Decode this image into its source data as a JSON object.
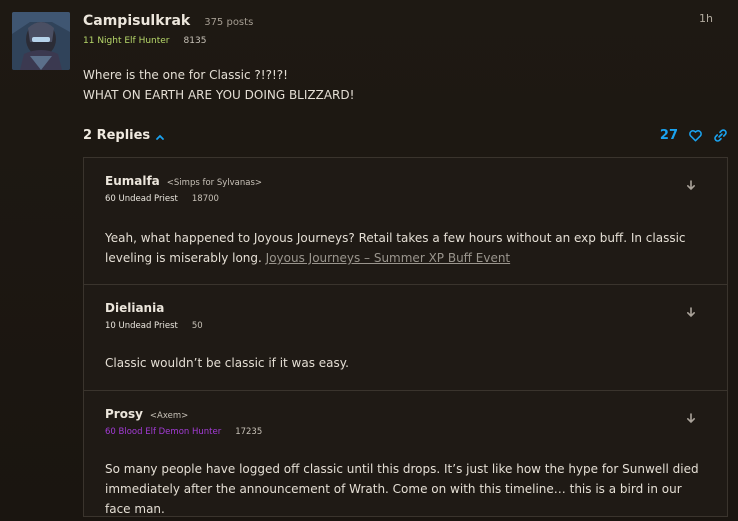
{
  "post": {
    "author": "Campisulkrak",
    "post_count": "375 posts",
    "class_line": "11 Night Elf Hunter",
    "achievement_points": "8135",
    "time_ago": "1h",
    "body_lines": [
      "Where is the one for Classic ?!?!?!",
      "WHAT ON EARTH ARE YOU DOING BLIZZARD!"
    ],
    "replies_label": "2 Replies",
    "like_count": "27"
  },
  "replies": [
    {
      "author": "Eumalfa",
      "tag": "<Simps for Sylvanas>",
      "class_line": "60 Undead Priest",
      "score": "18700",
      "body": "Yeah, what happened to Joyous Journeys? Retail takes a few hours without an exp buff. In classic leveling is miserably long. ",
      "link": "Joyous Journeys – Summer XP Buff Event"
    },
    {
      "author": "Dieliania",
      "class_line": "10 Undead Priest",
      "score": "50",
      "body": "Classic wouldn’t be classic if it was easy."
    },
    {
      "author": "Prosy",
      "tag": "<Axem>",
      "class_line": "60 Blood Elf Demon Hunter",
      "score": "17235",
      "body": "So many people have logged off classic until this drops. It’s just like how the hype for Sunwell died immediately after the announcement of Wrath. Come on with this timeline… this is a bird in our face man."
    }
  ],
  "colors": {
    "hunter": "#b7d86a",
    "priest": "#eae6de",
    "demon_hunter": "#a33bd6",
    "accent_blue": "#1aa3f0"
  },
  "icons": {
    "replies_toggle": "chevron-up-icon",
    "like": "heart-icon",
    "share": "link-icon",
    "jump": "arrow-down-icon"
  }
}
